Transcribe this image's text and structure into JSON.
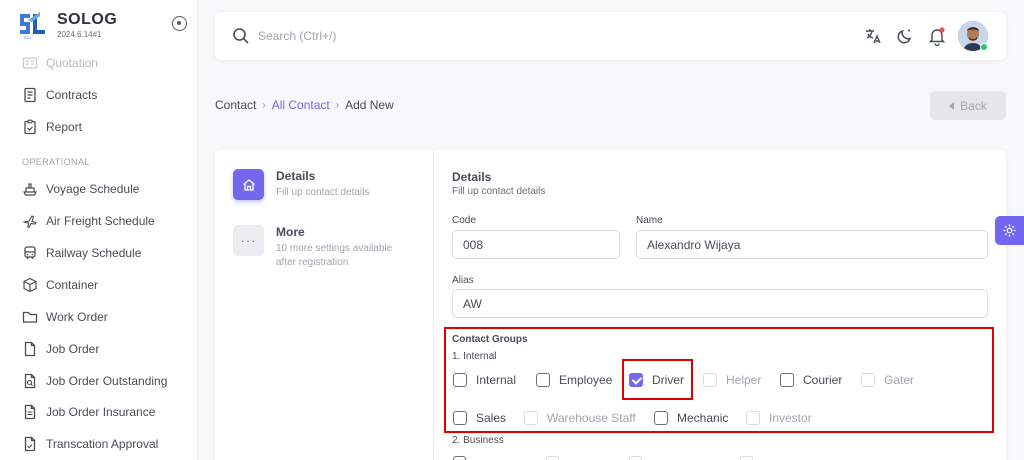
{
  "brand": {
    "name": "SOLOG",
    "version": "2024.6.14#1",
    "logo_text": "SCL"
  },
  "sidebar": {
    "section_operational": "OPERATIONAL",
    "items": [
      {
        "label": "Quotation",
        "icon": "quotation-icon"
      },
      {
        "label": "Contracts",
        "icon": "contracts-icon"
      },
      {
        "label": "Report",
        "icon": "report-icon"
      },
      {
        "label": "Voyage Schedule",
        "icon": "ship-icon"
      },
      {
        "label": "Air Freight Schedule",
        "icon": "plane-icon"
      },
      {
        "label": "Railway Schedule",
        "icon": "train-icon"
      },
      {
        "label": "Container",
        "icon": "box-icon"
      },
      {
        "label": "Work Order",
        "icon": "folder-icon"
      },
      {
        "label": "Job Order",
        "icon": "file-icon"
      },
      {
        "label": "Job Order Outstanding",
        "icon": "file-search-icon"
      },
      {
        "label": "Job Order Insurance",
        "icon": "file-text-icon"
      },
      {
        "label": "Transcation Approval",
        "icon": "file-check-icon"
      }
    ]
  },
  "search": {
    "placeholder": "Search (Ctrl+/)"
  },
  "breadcrumb": {
    "root": "Contact",
    "parent": "All Contact",
    "current": "Add New",
    "separator": "›"
  },
  "back_button": {
    "label": "Back"
  },
  "steps": [
    {
      "title": "Details",
      "subtitle": "Fill up contact details"
    },
    {
      "title": "More",
      "subtitle": "10 more settings available after registration",
      "icon_text": "···"
    }
  ],
  "form": {
    "title": "Details",
    "subtitle": "Fill up contact details",
    "code": {
      "label": "Code",
      "value": "008"
    },
    "name": {
      "label": "Name",
      "value": "Alexandro Wijaya"
    },
    "alias": {
      "label": "Alias",
      "value": "AW"
    },
    "groups_title": "Contact Groups",
    "group_internal": "1. Internal",
    "group_business": "2. Business",
    "checkboxes": [
      {
        "label": "Internal",
        "checked": false,
        "disabled": false
      },
      {
        "label": "Employee",
        "checked": false,
        "disabled": false
      },
      {
        "label": "Driver",
        "checked": true,
        "disabled": false
      },
      {
        "label": "Helper",
        "checked": false,
        "disabled": true
      },
      {
        "label": "Courier",
        "checked": false,
        "disabled": false
      },
      {
        "label": "Gater",
        "checked": false,
        "disabled": true
      },
      {
        "label": "Sales",
        "checked": false,
        "disabled": false
      },
      {
        "label": "Warehouse Staff",
        "checked": false,
        "disabled": true
      },
      {
        "label": "Mechanic",
        "checked": false,
        "disabled": false
      },
      {
        "label": "Investor",
        "checked": false,
        "disabled": true
      }
    ]
  },
  "colors": {
    "accent": "#7367f0",
    "highlight": "#e00000",
    "online": "#28c76f",
    "notify": "#ea5455"
  }
}
